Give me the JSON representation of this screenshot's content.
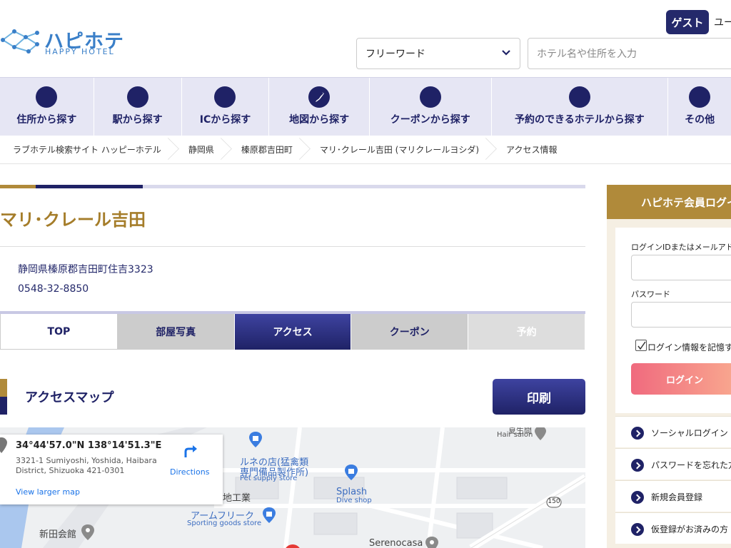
{
  "header": {
    "logo_text": "ハピホテ",
    "logo_sub": "HAPPY HOTEL",
    "guest_label": "ゲスト",
    "user_text": "ユー",
    "keyword_select": "フリーワード",
    "search_placeholder": "ホテル名や住所を入力"
  },
  "nav": [
    {
      "label": "住所から探す"
    },
    {
      "label": "駅から探す"
    },
    {
      "label": "ICから探す"
    },
    {
      "label": "地図から探す"
    },
    {
      "label": "クーポンから探す"
    },
    {
      "label": "予約のできるホテルから探す"
    },
    {
      "label": "その他"
    }
  ],
  "breadcrumb": [
    "ラブホテル検索サイト ハッピーホテル",
    "静岡県",
    "榛原郡吉田町",
    "マリ･クレール吉田 (マリクレールヨシダ)",
    "アクセス情報"
  ],
  "hotel": {
    "name": "マリ･クレール吉田",
    "address": "静岡県榛原郡吉田町住吉3323",
    "phone": "0548-32-8850"
  },
  "tabs": [
    {
      "label": "TOP"
    },
    {
      "label": "部屋写真"
    },
    {
      "label": "アクセス"
    },
    {
      "label": "クーポン"
    },
    {
      "label": "予約"
    }
  ],
  "access": {
    "title": "アクセスマップ",
    "print_label": "印刷"
  },
  "map": {
    "coords": "34°44'57.0\"N 138°14'51.3\"E",
    "address": "3321-1 Sumiyoshi, Yoshida, Haibara District, Shizuoka 421-0301",
    "larger_map": "View larger map",
    "directions": "Directions",
    "places": {
      "hair_salon": "Hair salon",
      "hair_top": "夏生間",
      "pet_line1": "ルネの店(猛禽類",
      "pet_line2": "専門備品製作所)",
      "pet_sub": "Pet supply store",
      "splash": "Splash",
      "splash_sub": "Dive shop",
      "chi_kogyo": "地工業",
      "armfreak": "アームフリーク",
      "armfreak_sub": "Sporting goods store",
      "shinden": "新田会館",
      "serenocasa": "Serenocasa",
      "route": "150"
    }
  },
  "login": {
    "title": "ハピホテ会員ログイン",
    "id_label": "ログインIDまたはメールアドレス",
    "password_label": "パスワード",
    "remember_label": "ログイン情報を記憶する",
    "login_button": "ログイン",
    "links": [
      "ソーシャルログイン",
      "パスワードを忘れた方",
      "新規会員登録",
      "仮登録がお済みの方"
    ]
  },
  "colors": {
    "navy": "#1f2266",
    "gold": "#b08a3a",
    "login_gradient_start": "#f06a7e",
    "login_gradient_end": "#f9a98f"
  }
}
